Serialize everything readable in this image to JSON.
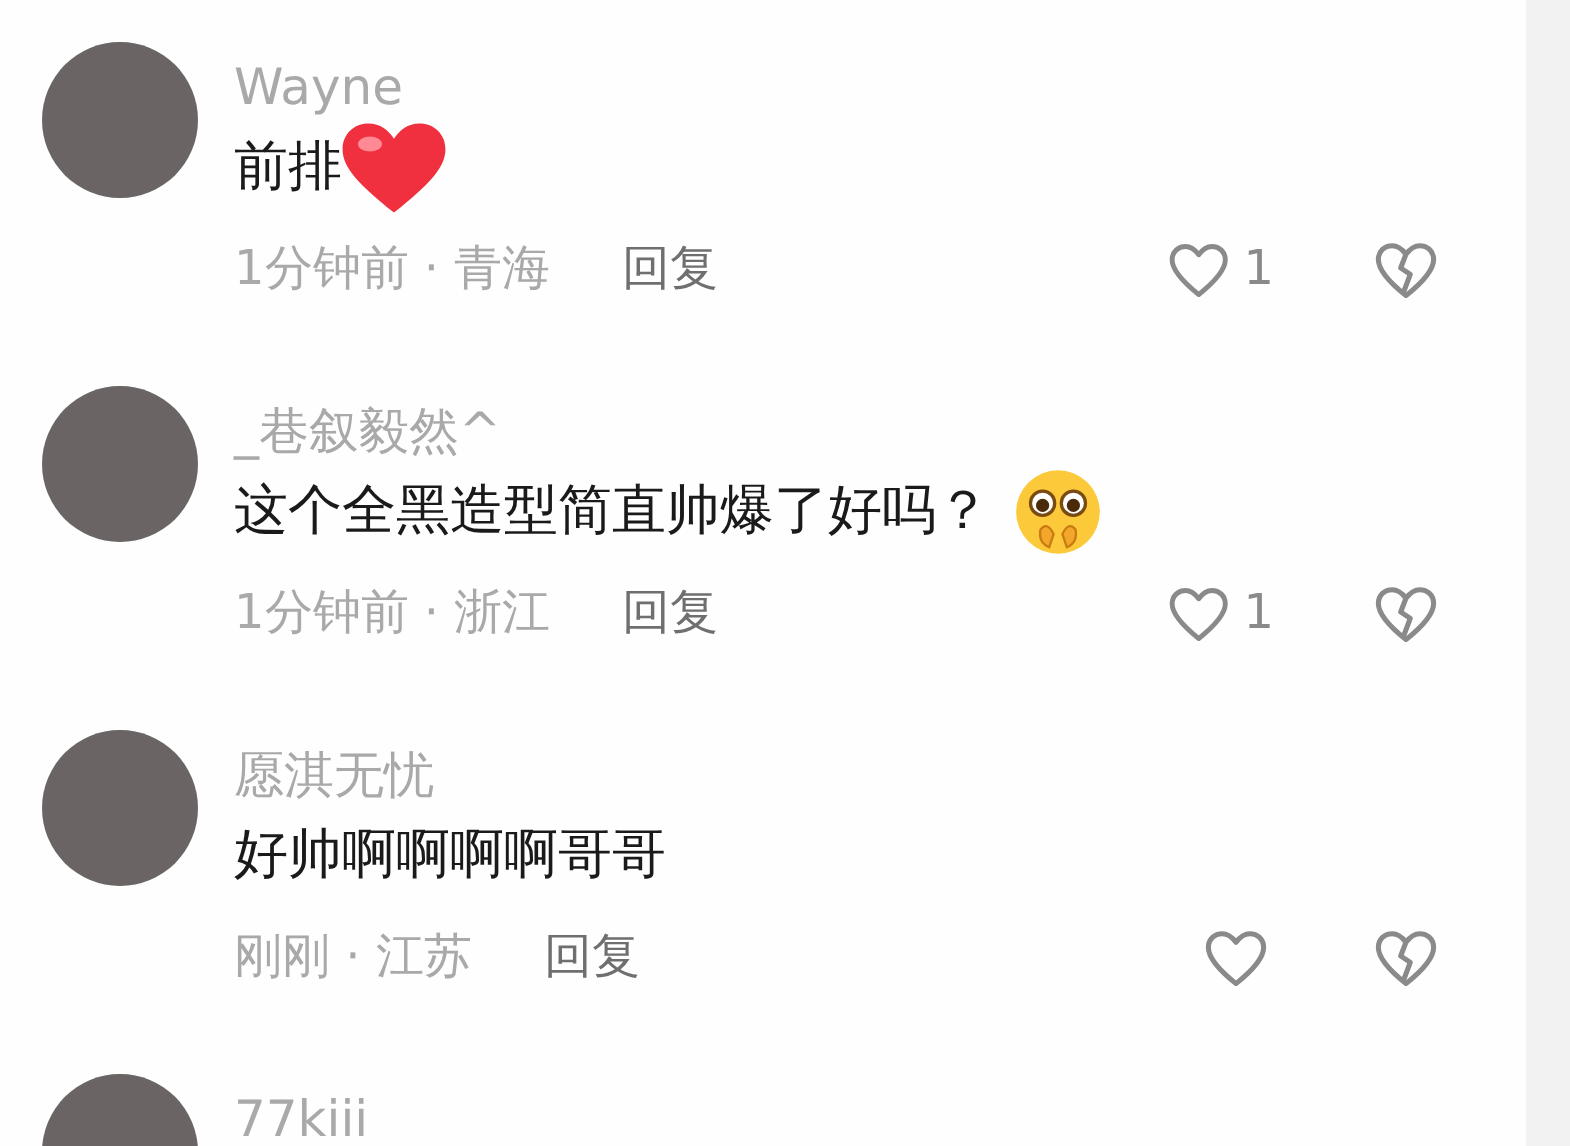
{
  "comments": [
    {
      "kind": "heart",
      "username": "Wayne",
      "content": "前排",
      "meta": "1分钟前 · 青海",
      "reply": "回复",
      "likes": "1"
    },
    {
      "kind": "pleading",
      "username": "_巷叙毅然^",
      "content": "这个全黑造型简直帅爆了好吗？",
      "meta": "1分钟前 · 浙江",
      "reply": "回复",
      "likes": "1"
    },
    {
      "kind": "plain",
      "username": "愿淇无忧",
      "content": "好帅啊啊啊啊哥哥",
      "meta": "刚刚 · 江苏",
      "reply": "回复"
    },
    {
      "username": "77kiii"
    }
  ]
}
